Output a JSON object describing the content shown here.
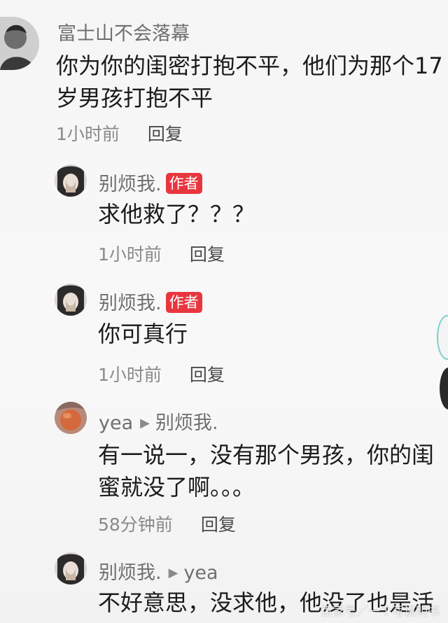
{
  "comments": [
    {
      "user": "富士山不会落幕",
      "lines": [
        "你为你的闺密打抱不平，他们为那个17",
        "岁男孩打抱不平"
      ],
      "time": "1小时前",
      "reply": "回复"
    },
    {
      "user": "别烦我.",
      "tag": "作者",
      "lines": [
        "求他救了？？？"
      ],
      "time": "1小时前",
      "reply": "回复"
    },
    {
      "user": "别烦我.",
      "tag": "作者",
      "lines": [
        "你可真行"
      ],
      "time": "1小时前",
      "reply": "回复"
    },
    {
      "user": "yea",
      "reply_to": "别烦我.",
      "lines": [
        "有一说一，没有那个男孩，你的闺",
        "蜜就没了啊。。。"
      ],
      "time": "58分钟前",
      "reply": "回复"
    },
    {
      "user": "别烦我.",
      "reply_to": "yea",
      "lines": [
        "不好意思，没求他，他没了也是活"
      ]
    }
  ],
  "watermark": "百家号／一个写说明书"
}
